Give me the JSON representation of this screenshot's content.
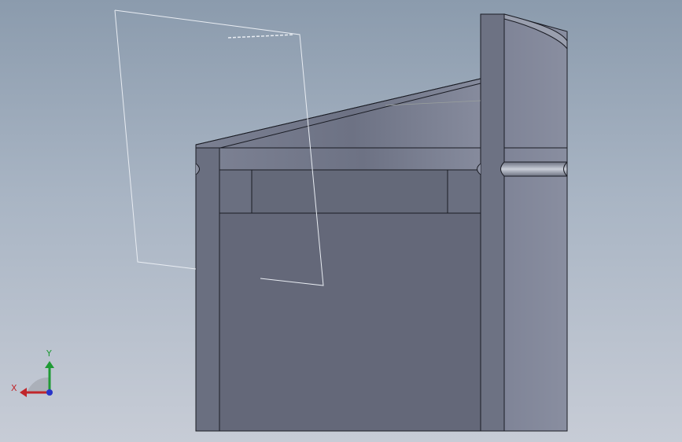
{
  "viewport": {
    "background_top": "#8b9bad",
    "background_bottom": "#c7ccd6"
  },
  "model": {
    "body_color": "#6a6f80",
    "face_dark": "#636879",
    "face_light": "#858a9c",
    "edge_color": "#1a1c24"
  },
  "sketch_plane": {
    "edge_color": "#e8ecf2"
  },
  "triad": {
    "x_label": "X",
    "y_label": "Y",
    "x_color": "#c0262b",
    "y_color": "#1f9a35",
    "z_color": "#2834c8"
  }
}
